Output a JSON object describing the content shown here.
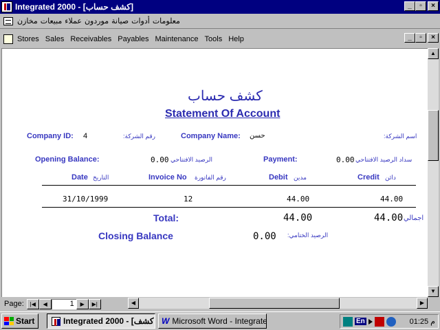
{
  "titlebar": {
    "title": "Integrated 2000 - [كشف حساب]",
    "btn_min": "_",
    "btn_max": "▫",
    "btn_close": "×"
  },
  "menu_ar": {
    "items": [
      "معلومات",
      "أدوات",
      "صيانة",
      "موردون",
      "عملاء",
      "مبيعات",
      "مخازن"
    ]
  },
  "menu_en": {
    "items": [
      "Stores",
      "Sales",
      "Receivables",
      "Payables",
      "Maintenance",
      "Tools",
      "Help"
    ]
  },
  "report": {
    "title_ar": "كشف حساب",
    "title_en": "Statement Of Account",
    "company_id_label": "Company ID:",
    "company_id_value": "4",
    "company_id_label_ar": "رقم الشركة:",
    "company_name_label": "Company Name:",
    "company_name_value": "حسن",
    "company_name_label_ar": "اسم الشركة:",
    "opening_balance_label": "Opening Balance:",
    "opening_balance_value": "0.00",
    "opening_balance_label_ar": "الرصيد الافتتاحي",
    "payment_label": "Payment:",
    "payment_value": "0.00",
    "payment_label_ar": "سداد الرصيد الافتتاحي",
    "columns": {
      "date": "Date",
      "date_ar": "التاريخ",
      "invoice": "Invoice No",
      "invoice_ar": "رقم الفاتورة",
      "debit": "Debit",
      "debit_ar": "مدين",
      "credit": "Credit",
      "credit_ar": "دائن"
    },
    "rows": [
      {
        "date": "31/10/1999",
        "invoice": "12",
        "debit": "44.00",
        "credit": "44.00"
      }
    ],
    "total_label": "Total:",
    "total_debit": "44.00",
    "total_credit": "44.00",
    "total_label_ar": "اجمالي",
    "closing_balance_label": "Closing Balance",
    "closing_balance_value": "0.00",
    "closing_balance_label_ar": "الرصيد الختامي:"
  },
  "navbar": {
    "page_label": "Page:",
    "page_value": "1",
    "first": "|◀",
    "prev": "◀",
    "next": "▶",
    "last": "▶|"
  },
  "taskbar": {
    "start": "Start",
    "task1": "Integrated 2000 - [كشف",
    "task2": "Microsoft Word - Integrate...",
    "lang": "En",
    "clock": "م 01:25"
  },
  "colors": {
    "titlebar": "#000080",
    "accent_text": "#3737c0"
  }
}
